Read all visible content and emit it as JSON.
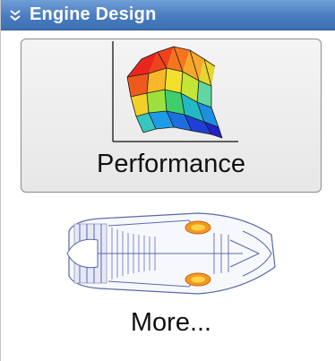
{
  "panel": {
    "header_title": "Engine Design",
    "header_icon": "double-chevron-down-icon"
  },
  "tiles": {
    "performance": {
      "label": "Performance",
      "icon": "surface-plot-icon"
    },
    "more": {
      "label": "More...",
      "icon": "turbofan-engine-icon"
    }
  },
  "colors": {
    "header_blue": "#4a7cc0",
    "flame_orange": "#f39a1e"
  }
}
